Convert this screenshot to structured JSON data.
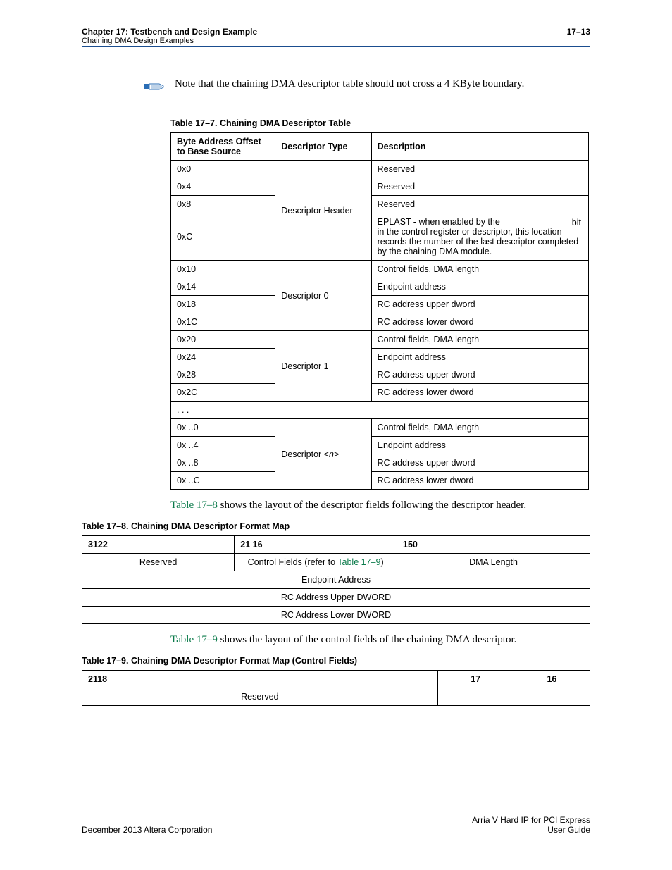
{
  "header": {
    "chapter": "Chapter 17:  Testbench and Design Example",
    "subtitle": "Chaining DMA Design Examples",
    "page_num": "17–13"
  },
  "note": {
    "text": "Note that the chaining DMA descriptor table should not cross a 4 KByte boundary."
  },
  "table7": {
    "caption": "Table 17–7.  Chaining DMA Descriptor Table",
    "headers": {
      "offset": "Byte Address Offset to Base Source",
      "type": "Descriptor Type",
      "desc": "Description"
    },
    "header_group": {
      "label": "Descriptor Header",
      "rows": [
        {
          "offset": "0x0",
          "desc": "Reserved"
        },
        {
          "offset": "0x4",
          "desc": "Reserved"
        },
        {
          "offset": "0x8",
          "desc": "Reserved"
        }
      ],
      "eplast": {
        "offset": "0xC",
        "desc_main": "EPLAST - when enabled by the",
        "desc_bit": "bit",
        "desc_rest": "in the control register or descriptor, this location records the number of the last descriptor completed by the chaining DMA module."
      }
    },
    "descriptors": [
      {
        "label": "Descriptor 0",
        "rows": [
          {
            "offset": "0x10",
            "desc": "Control fields, DMA length"
          },
          {
            "offset": "0x14",
            "desc": "Endpoint address"
          },
          {
            "offset": "0x18",
            "desc": "RC address upper dword"
          },
          {
            "offset": "0x1C",
            "desc": "RC address lower dword"
          }
        ]
      },
      {
        "label": "Descriptor 1",
        "rows": [
          {
            "offset": "0x20",
            "desc": "Control fields, DMA length"
          },
          {
            "offset": "0x24",
            "desc": "Endpoint address"
          },
          {
            "offset": "0x28",
            "desc": "RC address upper dword"
          },
          {
            "offset": "0x2C",
            "desc": "RC address lower dword"
          }
        ]
      }
    ],
    "ellipsis": ". . .",
    "descriptor_n": {
      "label_pre": "Descriptor <",
      "label_n": "n",
      "label_post": ">",
      "rows": [
        {
          "offset": "0x ..0",
          "desc": "Control fields, DMA length"
        },
        {
          "offset": "0x ..4",
          "desc": "Endpoint address"
        },
        {
          "offset": "0x ..8",
          "desc": "RC address upper dword"
        },
        {
          "offset": "0x ..C",
          "desc": "RC address lower dword"
        }
      ]
    }
  },
  "para1": {
    "link": "Table 17–8",
    "rest": " shows the layout of the descriptor fields following the descriptor header."
  },
  "table8": {
    "caption": "Table 17–8.  Chaining DMA Descriptor Format Map",
    "headers": {
      "c1": "3122",
      "c2": "21 16",
      "c3": "150"
    },
    "row1": {
      "reserved": "Reserved",
      "ctrl_pre": "Control Fields (refer to ",
      "ctrl_link": "Table 17–9",
      "ctrl_post": ")",
      "dma": "DMA Length"
    },
    "rows_full": {
      "ep": "Endpoint Address",
      "upper": "RC Address Upper DWORD",
      "lower": "RC Address Lower DWORD"
    }
  },
  "para2": {
    "link": "Table 17–9",
    "rest": " shows the layout of the control fields of the chaining DMA descriptor."
  },
  "table9": {
    "caption": "Table 17–9.  Chaining DMA Descriptor Format Map (Control Fields)",
    "headers": {
      "c1": "2118",
      "c2": "17",
      "c3": "16"
    },
    "reserved": "Reserved"
  },
  "footer": {
    "left": "December 2013   Altera Corporation",
    "right1": "Arria V Hard IP for PCI Express",
    "right2": "User Guide"
  }
}
